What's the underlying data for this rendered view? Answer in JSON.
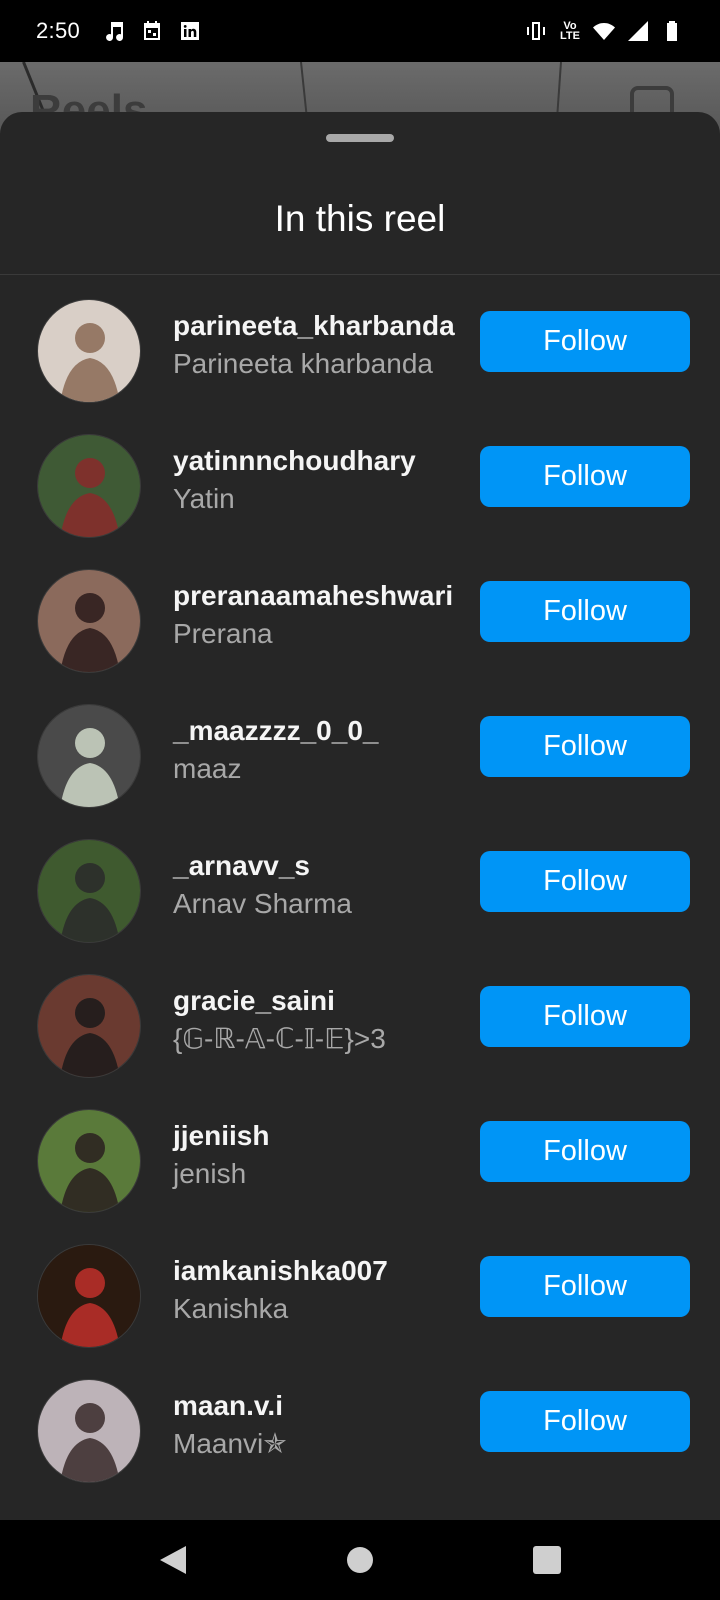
{
  "status_bar": {
    "time": "2:50",
    "left_icons": [
      "music-icon",
      "calendar-icon",
      "linkedin-icon"
    ],
    "right_icons": [
      "vibrate-icon",
      "volte-icon",
      "wifi-icon",
      "signal-icon",
      "battery-icon"
    ],
    "volte_label": "Vo LTE"
  },
  "background": {
    "title_partial": "Reels",
    "icon": "camera-icon"
  },
  "sheet": {
    "title": "In this reel"
  },
  "users": [
    {
      "username": "parineeta_kharbanda",
      "name": "Parineeta kharbanda",
      "button": "Follow",
      "avatar_colors": [
        "#d9cfc7",
        "#8a6a55"
      ]
    },
    {
      "username": "yatinnnchoudhary",
      "name": "Yatin",
      "button": "Follow",
      "avatar_colors": [
        "#3f5a35",
        "#8a2a2a"
      ]
    },
    {
      "username": "preranaamaheshwari",
      "name": "Prerana",
      "button": "Follow",
      "avatar_colors": [
        "#8b6a5c",
        "#2a1a1a"
      ]
    },
    {
      "username": "_maazzzz_0_0_",
      "name": "maaz",
      "button": "Follow",
      "avatar_colors": [
        "#4a4a4a",
        "#cfd8c8"
      ]
    },
    {
      "username": "_arnavv_s",
      "name": "Arnav Sharma",
      "button": "Follow",
      "avatar_colors": [
        "#3f5a2f",
        "#2a2a2a"
      ]
    },
    {
      "username": "gracie_saini",
      "name": "{𝔾-ℝ-𝔸-ℂ-𝕀-𝔼}>3",
      "button": "Follow",
      "avatar_colors": [
        "#6a3a30",
        "#1a1a1a"
      ]
    },
    {
      "username": "jjeniish",
      "name": "jenish",
      "button": "Follow",
      "avatar_colors": [
        "#5a7a3a",
        "#2a2020"
      ]
    },
    {
      "username": "iamkanishka007",
      "name": "Kanishka",
      "button": "Follow",
      "avatar_colors": [
        "#2a1a10",
        "#c0302a"
      ]
    },
    {
      "username": "maan.v.i",
      "name": "Maanvi✯",
      "button": "Follow",
      "avatar_colors": [
        "#bdb3b8",
        "#3a2a2a"
      ]
    }
  ],
  "nav_bar": {
    "buttons": [
      "back-icon",
      "home-icon",
      "recents-icon"
    ]
  },
  "colors": {
    "sheet_bg": "#262626",
    "follow_button": "#0095f6",
    "secondary_text": "#a8a8a8"
  }
}
